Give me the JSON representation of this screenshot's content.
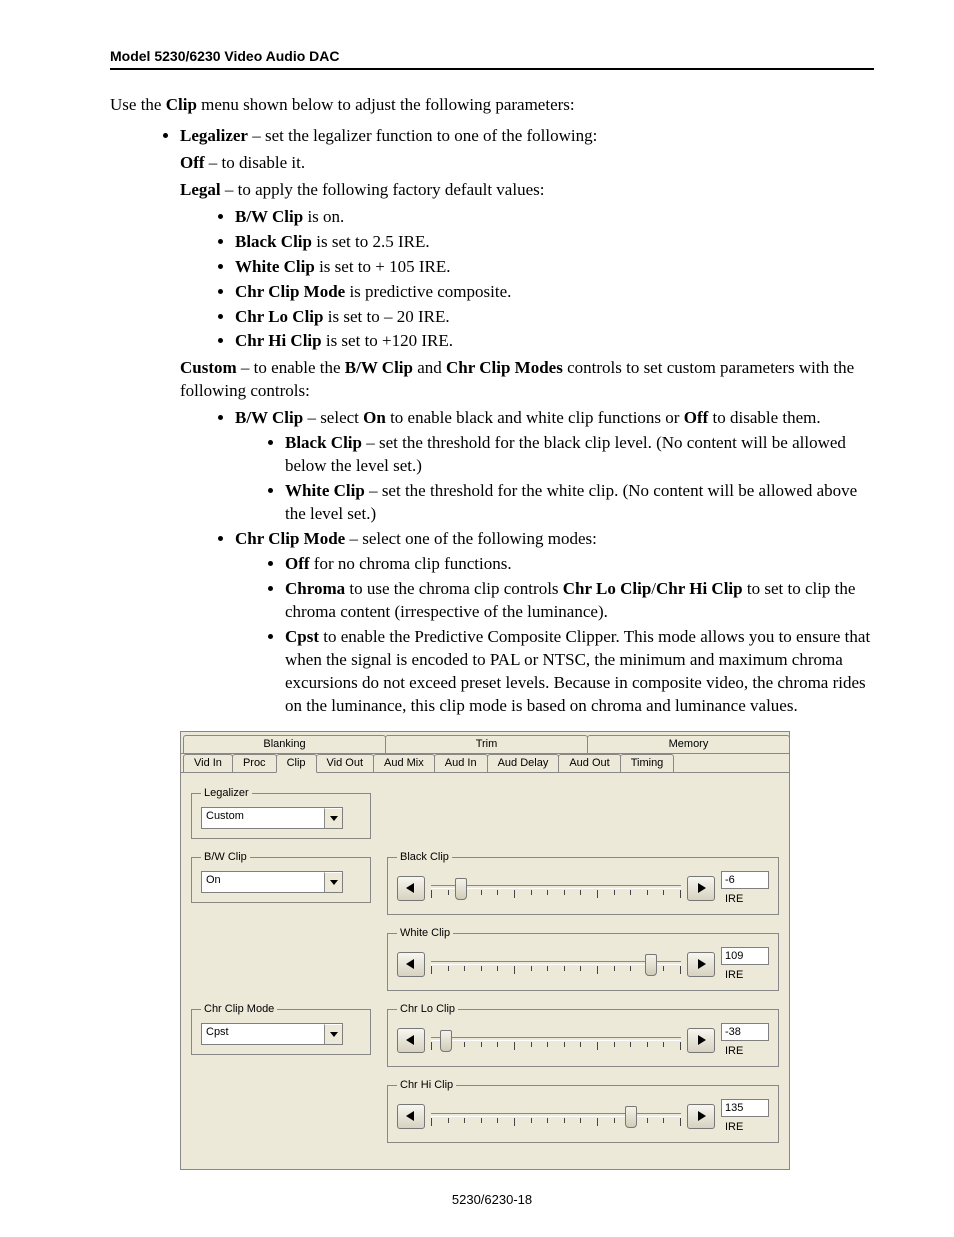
{
  "header": "Model 5230/6230 Video Audio DAC",
  "intro_pre": "Use the ",
  "intro_bold": "Clip",
  "intro_post": " menu shown below to adjust the following parameters:",
  "legalizer_b": "Legalizer",
  "legalizer_t": " – set the legalizer function to one of the following:",
  "off_b": "Off",
  "off_t": " – to disable it.",
  "legal_b": "Legal",
  "legal_t": " – to apply the following factory default values:",
  "legal_items": {
    "a_b": "B/W Clip",
    "a_t": " is on.",
    "b_b": "Black Clip",
    "b_t": " is set to 2.5 IRE.",
    "c_b": "White Clip",
    "c_t": " is set to + 105 IRE.",
    "d_b": "Chr Clip Mode",
    "d_t": " is predictive composite.",
    "e_b": "Chr Lo Clip",
    "e_t": " is set to – 20 IRE.",
    "f_b": "Chr Hi Clip",
    "f_t": " is set to +120 IRE."
  },
  "custom_b1": "Custom",
  "custom_t1": " – to enable the ",
  "custom_b2": "B/W Clip",
  "custom_t2": " and ",
  "custom_b3": "Chr Clip Modes",
  "custom_t3": " controls to set custom parameters with the following controls:",
  "bw_b": "B/W Clip",
  "bw_t1": " – select ",
  "bw_on": "On",
  "bw_t2": " to enable black and white clip functions or ",
  "bw_off": "Off",
  "bw_t3": " to disable them.",
  "black_b": "Black Clip",
  "black_t": " – set the threshold for the black clip level. (No content will be allowed below the level set.)",
  "white_b": "White Clip",
  "white_t": " – set the threshold for the white clip. (No content will be allowed above the level set.)",
  "chr_b": "Chr Clip Mode",
  "chr_t": " – select one of the following modes:",
  "chr_off_b": "Off",
  "chr_off_t": " for no chroma clip functions.",
  "chr_ch_b": "Chroma",
  "chr_ch_t1": " to use the chroma clip controls ",
  "chr_ch_b2": "Chr Lo Clip",
  "chr_ch_s": "/",
  "chr_ch_b3": "Chr Hi Clip",
  "chr_ch_t2": " to set to clip the chroma content (irrespective of the luminance).",
  "cpst_b": "Cpst",
  "cpst_t": " to enable the Predictive Composite Clipper. This mode allows you to ensure that when the signal is encoded to PAL or NTSC, the minimum and maximum chroma excursions do not exceed preset levels. Because in composite video, the chroma rides on the luminance, this clip mode is based on chroma and luminance values.",
  "tabs_top": {
    "a": "Blanking",
    "b": "Trim",
    "c": "Memory"
  },
  "tabs_bot": {
    "a": "Vid In",
    "b": "Proc",
    "c": "Clip",
    "d": "Vid Out",
    "e": "Aud Mix",
    "f": "Aud In",
    "g": "Aud Delay",
    "h": "Aud Out",
    "i": "Timing"
  },
  "groups": {
    "legalizer": "Legalizer",
    "bwclip": "B/W Clip",
    "blackclip": "Black Clip",
    "whiteclip": "White Clip",
    "chrmode": "Chr Clip Mode",
    "chrlo": "Chr Lo Clip",
    "chrhi": "Chr Hi Clip"
  },
  "values": {
    "legalizer": "Custom",
    "bwclip": "On",
    "chrmode": "Cpst",
    "black": "-6",
    "white": "109",
    "chrlo": "-38",
    "chrhi": "135",
    "unit": "IRE"
  },
  "footer": "5230/6230-18"
}
